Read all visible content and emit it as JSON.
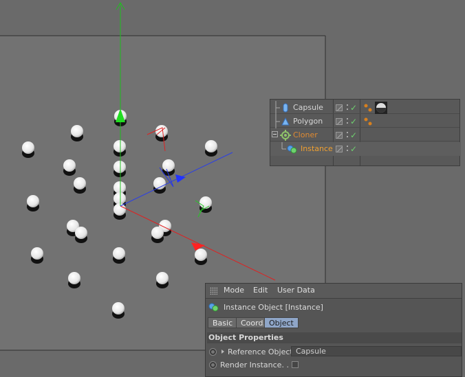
{
  "object_manager": {
    "objects": [
      {
        "name": "Capsule",
        "icon": "capsule-icon"
      },
      {
        "name": "Polygon",
        "icon": "polygon-icon"
      },
      {
        "name": "Cloner",
        "icon": "cloner-icon"
      },
      {
        "name": "Instance",
        "icon": "instance-icon"
      }
    ]
  },
  "attribute_manager": {
    "menu": {
      "mode": "Mode",
      "edit": "Edit",
      "user_data": "User Data"
    },
    "title": "Instance Object [Instance]",
    "tabs": {
      "basic": "Basic",
      "coord": "Coord.",
      "object": "Object"
    },
    "section": "Object Properties",
    "properties": {
      "reference_label": "Reference Object",
      "reference_value": "Capsule",
      "render_label": "Render Instance. . ."
    }
  },
  "colors": {
    "viewport_bg": "#727272",
    "axis_x": "#e02020",
    "axis_y": "#20c020",
    "axis_z": "#2040e0",
    "cloner_text": "#e08a32",
    "active_tab": "#8fa6c8"
  }
}
